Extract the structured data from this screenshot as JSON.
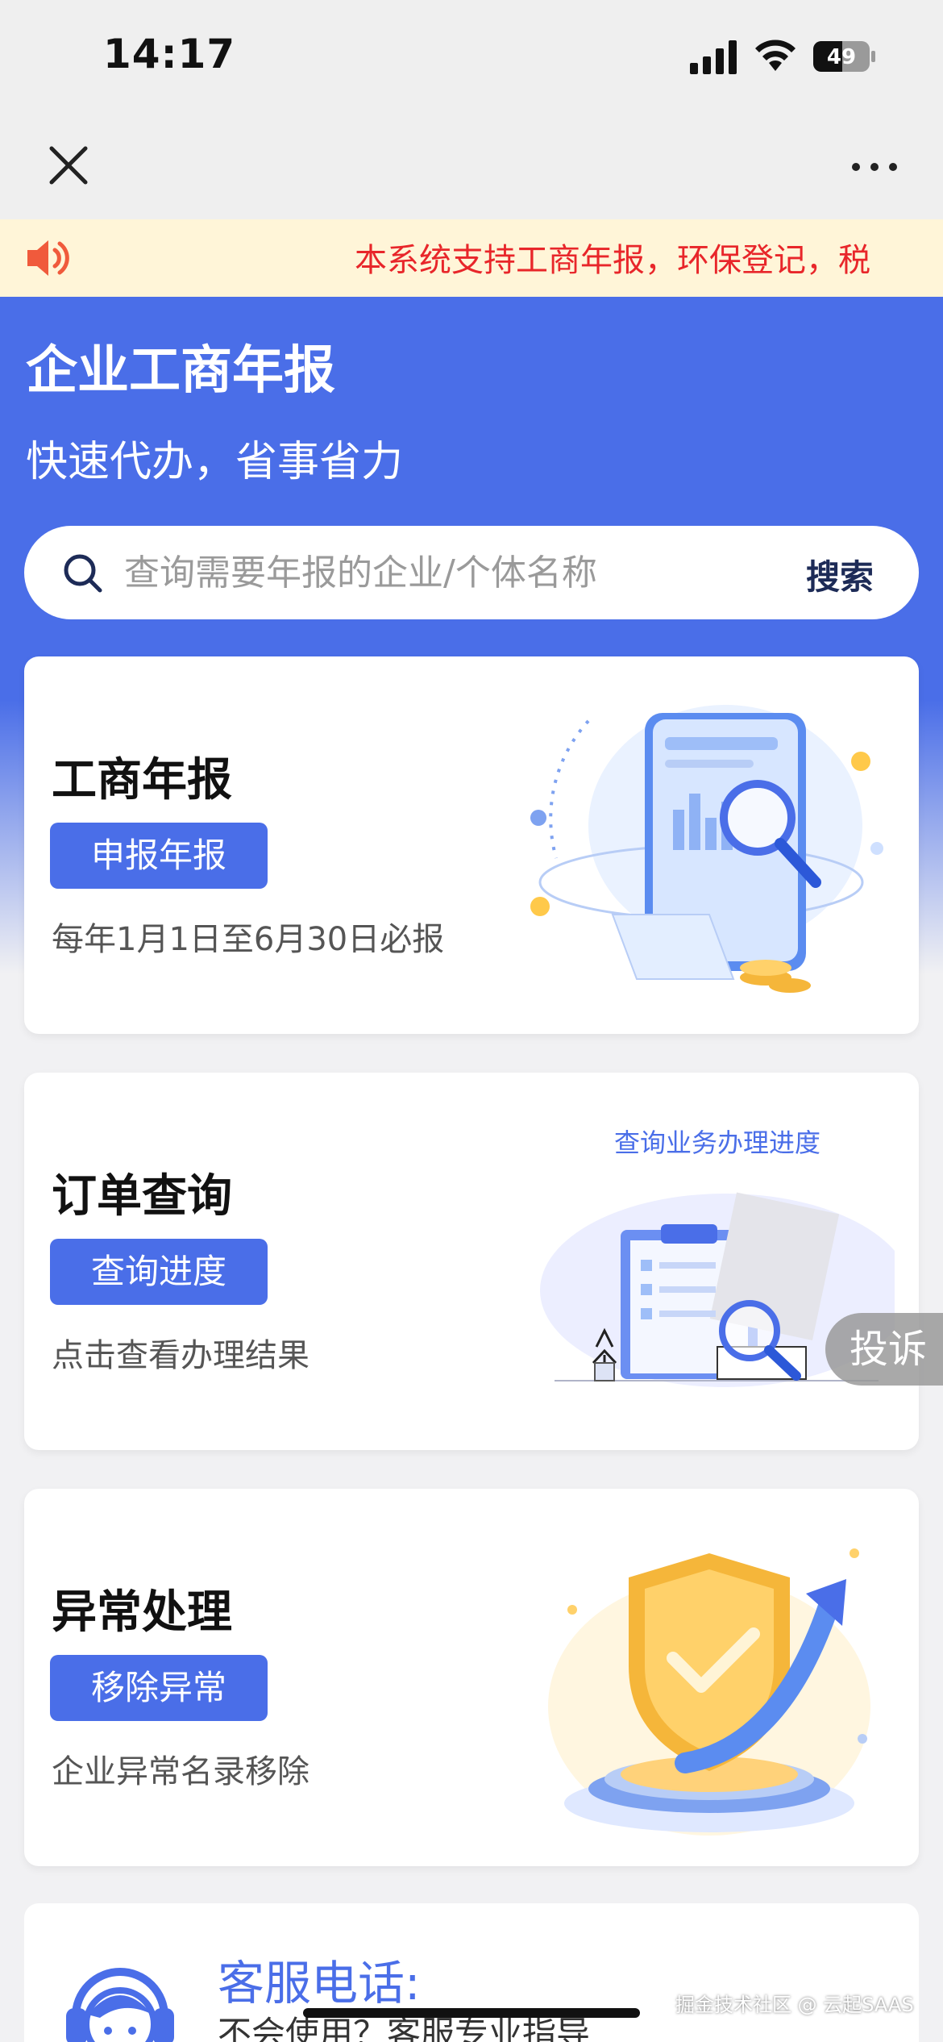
{
  "status_bar": {
    "time": "14:17",
    "battery": "49"
  },
  "nav": {
    "close_icon": "close-icon",
    "more_icon": "more-icon"
  },
  "notice": {
    "icon": "speaker-icon",
    "text": "本系统支持工商年报，环保登记，税"
  },
  "hero": {
    "title": "企业工商年报",
    "subtitle": "快速代办，省事省力",
    "search_placeholder": "查询需要年报的企业/个体名称",
    "search_button": "搜索"
  },
  "cards": [
    {
      "title": "工商年报",
      "button": "申报年报",
      "desc": "每年1月1日至6月30日必报"
    },
    {
      "title": "订单查询",
      "button": "查询进度",
      "desc": "点击查看办理结果",
      "illus_caption": "查询业务办理进度"
    },
    {
      "title": "异常处理",
      "button": "移除异常",
      "desc": "企业异常名录移除"
    }
  ],
  "service": {
    "title": "客服电话:",
    "desc": "不会使用？客服专业指导"
  },
  "complaint": "投诉",
  "watermark": "掘金技术社区 @ 云起SAAS",
  "colors": {
    "primary": "#4a6ee8",
    "notice_bg": "#fff5d8",
    "notice_text": "#e8262a"
  }
}
